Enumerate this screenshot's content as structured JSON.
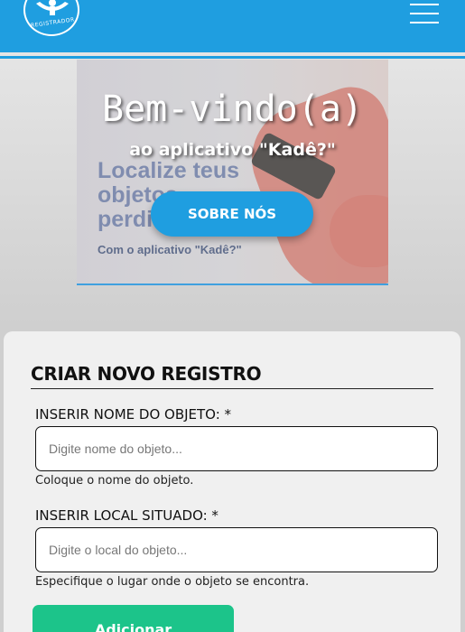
{
  "header": {
    "logo_text": "REGISTRADOR",
    "menu_icon": "hamburger-menu-icon",
    "color": "#1f9ee0"
  },
  "banner": {
    "bg_text": "Localize teus objetos perdidos",
    "bg_sub": "Com o aplicativo \"Kadê?\"",
    "title": "Bem-vindo(a)",
    "subtitle": "ao aplicativo \"Kadê?\"",
    "about_label": "SOBRE NÓS"
  },
  "form": {
    "title": "CRIAR NOVO REGISTRO",
    "name_label": "INSERIR NOME DO OBJETO: *",
    "name_placeholder": "Digite nome do objeto...",
    "name_help": "Coloque o nome do objeto.",
    "location_label": "INSERIR LOCAL SITUADO: *",
    "location_placeholder": "Digite o local do objeto...",
    "location_help": "Especifique o lugar onde o objeto se encontra.",
    "add_label": "Adicionar",
    "add_color": "#1cc48a"
  }
}
